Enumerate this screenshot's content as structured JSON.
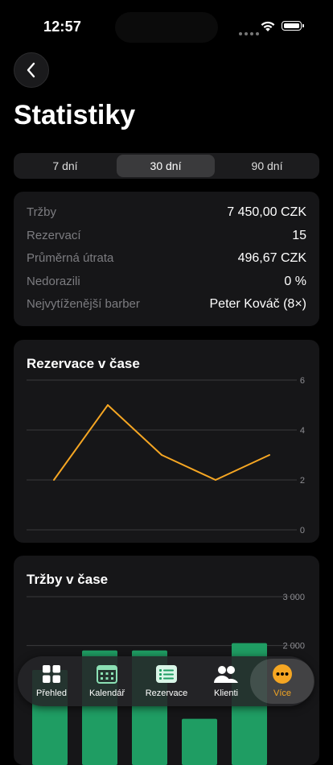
{
  "status": {
    "time": "12:57"
  },
  "page": {
    "title": "Statistiky"
  },
  "periods": [
    {
      "label": "7 dní",
      "active": false
    },
    {
      "label": "30 dní",
      "active": true
    },
    {
      "label": "90 dní",
      "active": false
    }
  ],
  "stats": [
    {
      "label": "Tržby",
      "value": "7 450,00 CZK"
    },
    {
      "label": "Rezervací",
      "value": "15"
    },
    {
      "label": "Průměrná útrata",
      "value": "496,67 CZK"
    },
    {
      "label": "Nedorazili",
      "value": "0 %"
    },
    {
      "label": "Nejvytíženější barber",
      "value": "Peter Kováč (8×)"
    }
  ],
  "reservations_chart": {
    "title": "Rezervace v čase",
    "chart_data": {
      "type": "line",
      "values": [
        2,
        5,
        3,
        2,
        3
      ],
      "ylim": [
        0,
        6
      ],
      "yticks": [
        "0",
        "2",
        "4",
        "6"
      ],
      "grid": true,
      "color": "#f5a623"
    }
  },
  "revenue_chart": {
    "title": "Tržby v čase",
    "chart_data": {
      "type": "bar",
      "values": [
        1500,
        1900,
        1900,
        500,
        2050
      ],
      "ylim": [
        0,
        3000
      ],
      "yticks": [
        "2 000",
        "3 000"
      ],
      "grid": true,
      "color": "#1f9d63"
    }
  },
  "tabs": [
    {
      "label": "Přehled",
      "icon": "grid-icon",
      "active": false
    },
    {
      "label": "Kalendář",
      "icon": "calendar-icon",
      "active": false
    },
    {
      "label": "Rezervace",
      "icon": "list-icon",
      "active": false
    },
    {
      "label": "Klienti",
      "icon": "people-icon",
      "active": false
    },
    {
      "label": "Více",
      "icon": "more-icon",
      "active": true
    }
  ],
  "colors": {
    "accent": "#f5a623",
    "bar": "#1f9d63",
    "card": "#161618"
  }
}
